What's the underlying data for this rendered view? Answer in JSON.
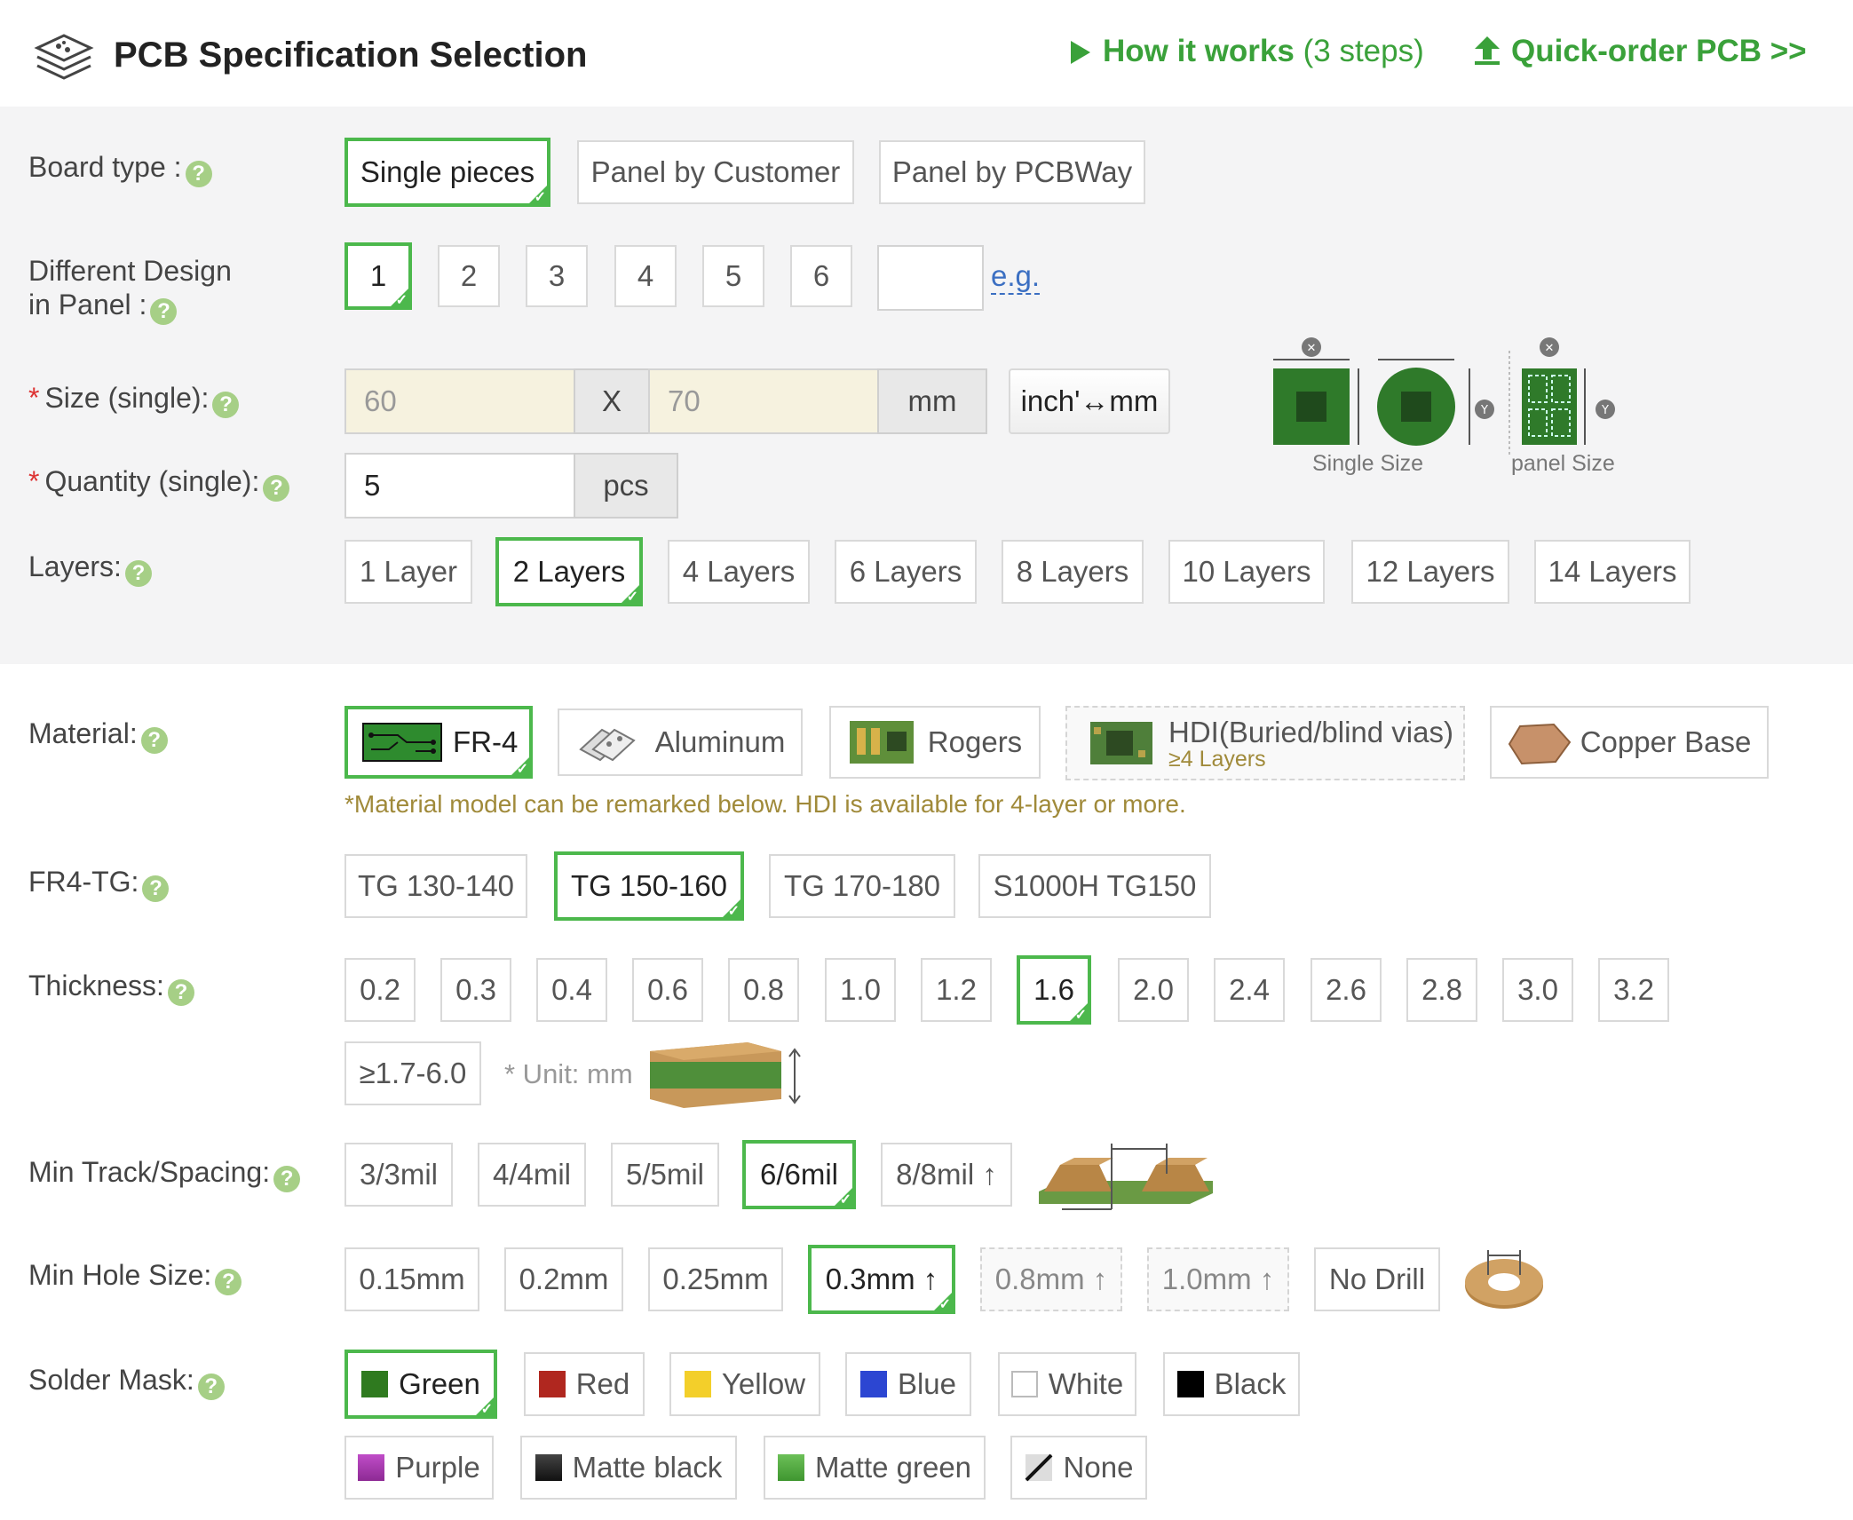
{
  "header": {
    "title": "PCB Specification Selection",
    "how_it_works": "How it works",
    "how_it_works_sub": "(3 steps)",
    "quick_order": "Quick-order PCB >>"
  },
  "board_type": {
    "label": "Board type :",
    "options": [
      "Single pieces",
      "Panel by Customer",
      "Panel by PCBWay"
    ],
    "selected": "Single pieces"
  },
  "different_design": {
    "label_line1": "Different Design",
    "label_line2": "in Panel :",
    "options": [
      "1",
      "2",
      "3",
      "4",
      "5",
      "6"
    ],
    "selected": "1",
    "custom_value": "",
    "eg": "e.g."
  },
  "size": {
    "label": "Size (single):",
    "x_value": "60",
    "separator": "X",
    "y_value": "70",
    "unit": "mm",
    "convert_button": "inch'↔mm",
    "single_size_caption": "Single Size",
    "panel_size_caption": "panel Size"
  },
  "quantity": {
    "label": "Quantity (single):",
    "value": "5",
    "unit": "pcs"
  },
  "layers": {
    "label": "Layers:",
    "options": [
      "1 Layer",
      "2 Layers",
      "4 Layers",
      "6 Layers",
      "8 Layers",
      "10 Layers",
      "12 Layers",
      "14 Layers"
    ],
    "selected": "2 Layers"
  },
  "material": {
    "label": "Material:",
    "options": [
      "FR-4",
      "Aluminum",
      "Rogers",
      "HDI(Buried/blind vias)",
      "Copper Base"
    ],
    "hdi_sub": "≥4 Layers",
    "selected": "FR-4",
    "note": "*Material model can be remarked below. HDI is available for 4-layer or more."
  },
  "fr4_tg": {
    "label": "FR4-TG:",
    "options": [
      "TG 130-140",
      "TG 150-160",
      "TG 170-180",
      "S1000H TG150"
    ],
    "selected": "TG 150-160"
  },
  "thickness": {
    "label": "Thickness:",
    "options": [
      "0.2",
      "0.3",
      "0.4",
      "0.6",
      "0.8",
      "1.0",
      "1.2",
      "1.6",
      "2.0",
      "2.4",
      "2.6",
      "2.8",
      "3.0",
      "3.2",
      "≥1.7-6.0"
    ],
    "selected": "1.6",
    "unit_note": "* Unit: mm"
  },
  "track": {
    "label": "Min Track/Spacing:",
    "options": [
      "3/3mil",
      "4/4mil",
      "5/5mil",
      "6/6mil",
      "8/8mil ↑"
    ],
    "selected": "6/6mil"
  },
  "hole": {
    "label": "Min Hole Size:",
    "options": [
      "0.15mm",
      "0.2mm",
      "0.25mm",
      "0.3mm ↑",
      "0.8mm ↑",
      "1.0mm ↑",
      "No Drill"
    ],
    "selected": "0.3mm ↑"
  },
  "solder_mask": {
    "label": "Solder Mask:",
    "options": [
      {
        "name": "Green",
        "color": "#2f7a1f"
      },
      {
        "name": "Red",
        "color": "#b0271f"
      },
      {
        "name": "Yellow",
        "color": "#f3cf2a"
      },
      {
        "name": "Blue",
        "color": "#2c46d2"
      },
      {
        "name": "White",
        "color": "#ffffff"
      },
      {
        "name": "Black",
        "color": "#000000"
      },
      {
        "name": "Purple",
        "color": "#a43bb0"
      },
      {
        "name": "Matte black",
        "color": "#222222"
      },
      {
        "name": "Matte green",
        "color": "#4fae3f"
      },
      {
        "name": "None",
        "color": "none"
      }
    ],
    "selected": "Green"
  },
  "colors": {
    "accent": "#4cb84c",
    "link": "#3aa13a",
    "help": "#a6cf86",
    "note": "#a08a3a"
  }
}
